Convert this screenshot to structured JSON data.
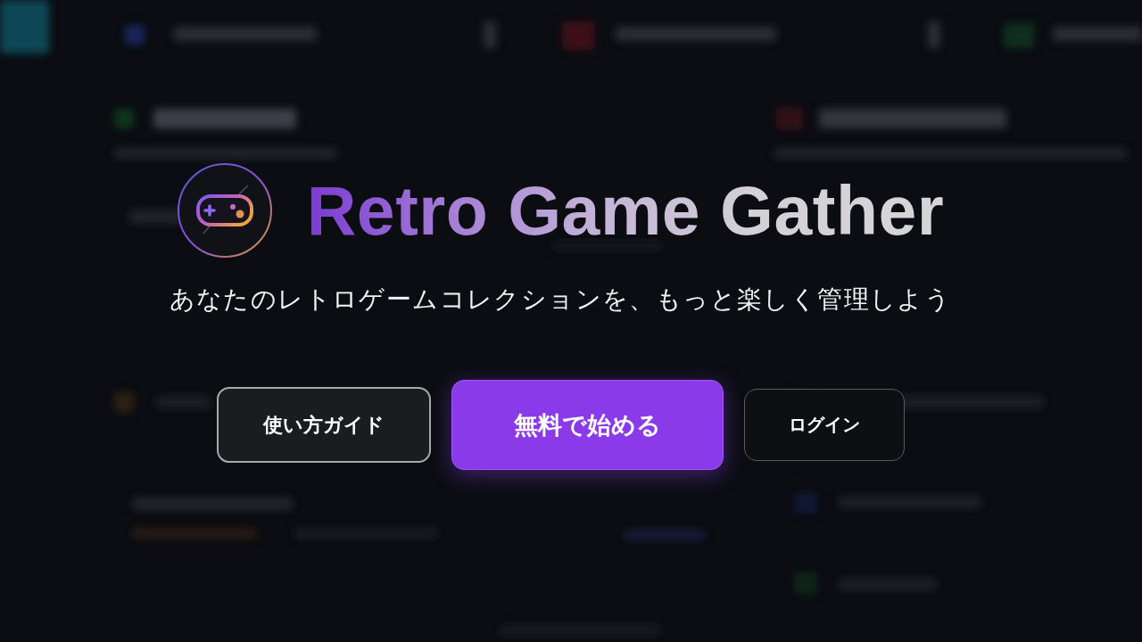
{
  "hero": {
    "title": "Retro Game Gather",
    "tagline": "あなたのレトロゲームコレクションを、もっと楽しく管理しよう"
  },
  "buttons": [
    {
      "label": "使い方ガイド",
      "kind": "secondary"
    },
    {
      "label": "無料で始める",
      "kind": "primary"
    },
    {
      "label": "ログイン",
      "kind": "outline"
    }
  ]
}
